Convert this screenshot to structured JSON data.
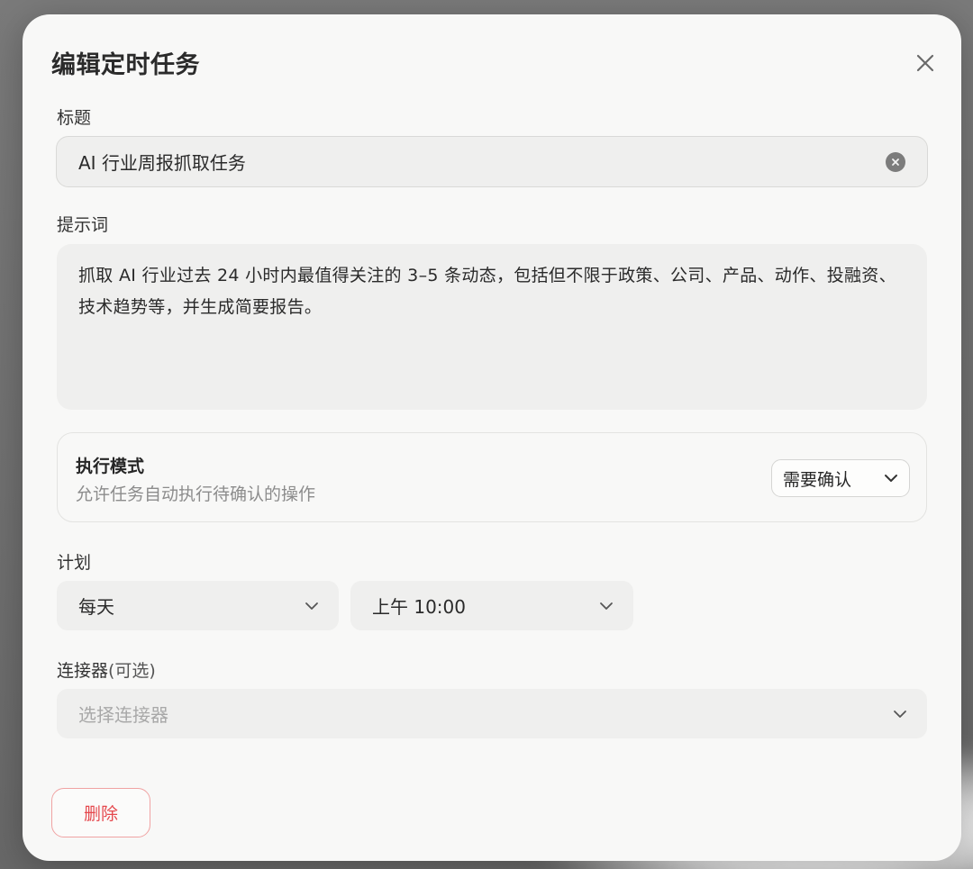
{
  "dialog": {
    "title": "编辑定时任务"
  },
  "title_field": {
    "label": "标题",
    "value": "AI 行业周报抓取任务"
  },
  "prompt_field": {
    "label": "提示词",
    "value": "抓取 AI 行业过去 24 小时内最值得关注的 3–5 条动态，包括但不限于政策、公司、产品、动作、投融资、技术趋势等，并生成简要报告。"
  },
  "execution_mode": {
    "title": "执行模式",
    "description": "允许任务自动执行待确认的操作",
    "selected": "需要确认"
  },
  "schedule": {
    "label": "计划",
    "frequency": "每天",
    "time": "上午 10:00"
  },
  "connector": {
    "label": "连接器",
    "optional_note": "(可选)",
    "placeholder": "选择连接器"
  },
  "actions": {
    "delete_label": "删除"
  },
  "colors": {
    "danger": "#e5484d",
    "surface": "#f8f8f7",
    "field_bg": "#efefee"
  }
}
